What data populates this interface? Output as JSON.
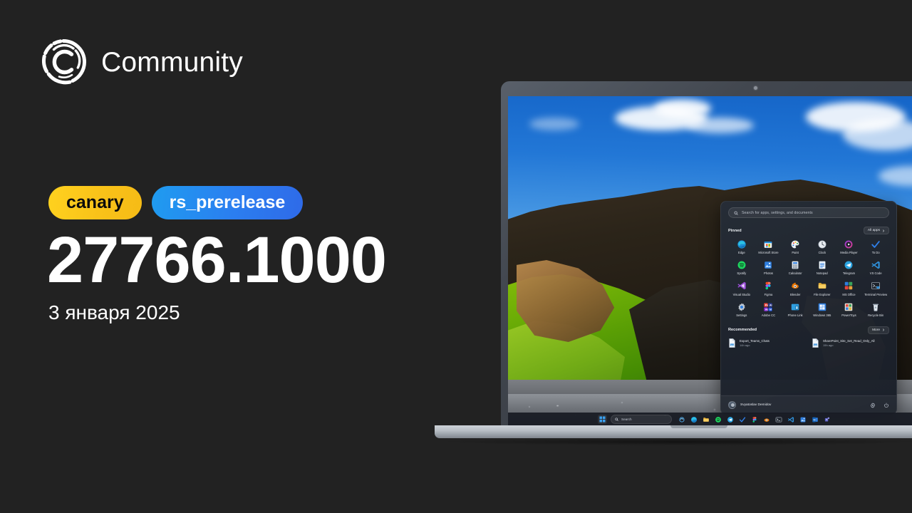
{
  "brand": {
    "title": "Community",
    "logo_icon": "community-c-ring-icon"
  },
  "release": {
    "channel_badge": "canary",
    "branch_badge": "rs_prerelease",
    "build_number": "27766.1000",
    "date": "3 января 2025",
    "colors": {
      "canary": "#f9c219",
      "branch": "#2b7ef0",
      "background": "#222222",
      "text": "#ffffff"
    }
  },
  "laptop": {
    "device": "laptop-mockup",
    "webcam_icon": "webcam-dot-icon",
    "wallpaper": "iceland-cliff-black-pebble-beach"
  },
  "start_menu": {
    "search": {
      "placeholder": "Search for apps, settings, and documents",
      "icon": "search-icon"
    },
    "pinned": {
      "title": "Pinned",
      "all_apps_label": "All apps",
      "all_apps_icon": "chevron-right-icon",
      "apps": [
        {
          "label": "Edge",
          "icon": "edge-icon"
        },
        {
          "label": "Microsoft Store",
          "icon": "microsoft-store-icon"
        },
        {
          "label": "Paint",
          "icon": "paint-icon"
        },
        {
          "label": "Clock",
          "icon": "clock-icon"
        },
        {
          "label": "Media Player",
          "icon": "media-player-icon"
        },
        {
          "label": "To Do",
          "icon": "to-do-icon"
        },
        {
          "label": "Spotify",
          "icon": "spotify-icon"
        },
        {
          "label": "Photos",
          "icon": "photos-icon"
        },
        {
          "label": "Calculator",
          "icon": "calculator-icon"
        },
        {
          "label": "Notepad",
          "icon": "notepad-icon"
        },
        {
          "label": "Telegram",
          "icon": "telegram-icon"
        },
        {
          "label": "VS Code",
          "icon": "vs-code-icon"
        },
        {
          "label": "Visual Studio",
          "icon": "visual-studio-icon"
        },
        {
          "label": "Figma",
          "icon": "figma-icon"
        },
        {
          "label": "Blender",
          "icon": "blender-icon"
        },
        {
          "label": "File Explorer",
          "icon": "file-explorer-icon"
        },
        {
          "label": "MS Office",
          "icon": "ms-office-icon"
        },
        {
          "label": "Terminal Preview",
          "icon": "terminal-preview-icon"
        },
        {
          "label": "Settings",
          "icon": "settings-gear-icon"
        },
        {
          "label": "Adobe CC",
          "icon": "adobe-cc-icon"
        },
        {
          "label": "Phone Link",
          "icon": "phone-link-icon"
        },
        {
          "label": "Windows 365",
          "icon": "windows-365-icon"
        },
        {
          "label": "PowerToys",
          "icon": "powertoys-icon"
        },
        {
          "label": "Recycle Bin",
          "icon": "recycle-bin-icon"
        }
      ]
    },
    "recommended": {
      "title": "Recommended",
      "more_label": "More",
      "more_icon": "chevron-right-icon",
      "items": [
        {
          "name": "Export_Teams_Chats",
          "meta": "14h ago",
          "icon": "document-icon"
        },
        {
          "name": "SharePoint_Site_Set_Read_Only_All",
          "meta": "15h ago",
          "icon": "document-icon"
        }
      ]
    },
    "footer": {
      "user_name": "Svyatoslav Demidov",
      "avatar_icon": "avatar-icon",
      "settings_icon": "gear-icon",
      "power_icon": "power-icon"
    }
  },
  "taskbar": {
    "start_icon": "windows-start-icon",
    "search": {
      "label": "Search",
      "icon": "search-icon"
    },
    "apps": [
      {
        "icon": "copilot-icon"
      },
      {
        "icon": "edge-icon"
      },
      {
        "icon": "file-explorer-icon"
      },
      {
        "icon": "spotify-icon"
      },
      {
        "icon": "telegram-icon"
      },
      {
        "icon": "to-do-icon"
      },
      {
        "icon": "figma-icon"
      },
      {
        "icon": "blender-icon"
      },
      {
        "icon": "terminal-icon"
      },
      {
        "icon": "vs-code-icon"
      },
      {
        "icon": "photos-icon"
      },
      {
        "icon": "outlook-icon"
      },
      {
        "icon": "teams-icon"
      }
    ]
  }
}
